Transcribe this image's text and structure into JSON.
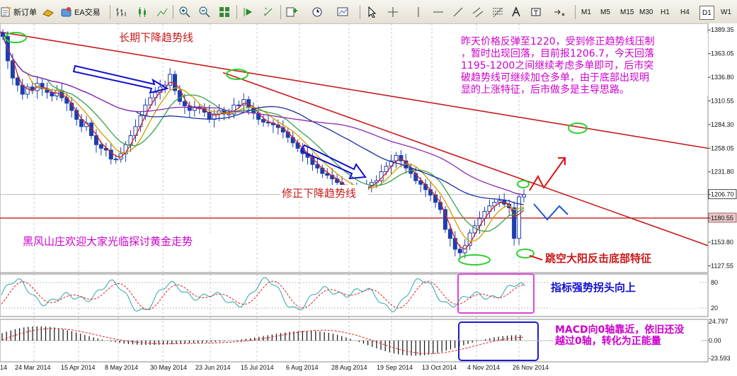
{
  "toolbar": {
    "new_order": "新订单",
    "ea_trading": "EA交易",
    "timeframes": [
      "M1",
      "M5",
      "M15",
      "M30",
      "H1",
      "H4",
      "D1",
      "W1"
    ],
    "active_timeframe": "D1"
  },
  "annotations": {
    "long_trend": "长期下降趋势线",
    "correction_trend": "修正下降趋势线",
    "welcome": "黑风山庄欢迎大家光临探讨黄金走势",
    "gap_candle": "跳空大阳反击底部特征",
    "indicator_note": "指标强势拐头向上",
    "macd_note_1": "MACD向0轴靠近，依旧还没",
    "macd_note_2": "越过0轴，转化为正能量",
    "analysis": [
      "昨天价格反弹至1220，受到修正趋势线压制",
      "，暂时出现回落，目前报1206.7，今天回落",
      "1195-1200之间继续考虑多单即可，后市突",
      "破趋势线可继续加仓多单，由于底部出现明",
      "显的上涨特征，后市做多是主导思路。"
    ]
  },
  "colors": {
    "candle": "#1c3fae",
    "ma_fast": "#d42020",
    "ma_mid": "#c9a000",
    "ma_slow": "#37a04a",
    "ma_blue": "#1a2fa0",
    "ma_purple": "#8b29b0",
    "trend": "#c81a1a",
    "ellipse": "#2ed02e",
    "magenta_text": "#cc00cc",
    "blue_text": "#1010cc",
    "price_marker": "#e8c8c8"
  },
  "chart_data": {
    "type": "candlestick",
    "price_axis": {
      "ticks": [
        "1389.35",
        "1363.05",
        "1336.80",
        "1310.55",
        "1284.30",
        "1258.05",
        "1231.80",
        "1206.70",
        "1180.55",
        "1153.80",
        "1127.55"
      ],
      "range": [
        1120,
        1395
      ],
      "current_price": "1206.70",
      "support_line": "1180.55"
    },
    "date_axis": [
      "14",
      "24 Mar 2014",
      "15 Apr 2014",
      "8 May 2014",
      "30 May 2014",
      "23 Jun 2014",
      "15 Jul 2014",
      "6 Aug 2014",
      "28 Aug 2014",
      "19 Sep 2014",
      "13 Oct 2014",
      "4 Nov 2014",
      "26 Nov 2014"
    ],
    "close_series": [
      1382,
      1355,
      1336,
      1328,
      1318,
      1326,
      1322,
      1330,
      1324,
      1320,
      1316,
      1322,
      1314,
      1308,
      1300,
      1290,
      1282,
      1286,
      1272,
      1262,
      1258,
      1256,
      1246,
      1246,
      1252,
      1262,
      1272,
      1282,
      1294,
      1306,
      1314,
      1320,
      1326,
      1328,
      1340,
      1322,
      1310,
      1305,
      1300,
      1304,
      1302,
      1298,
      1290,
      1296,
      1300,
      1296,
      1296,
      1306,
      1306,
      1312,
      1303,
      1297,
      1290,
      1287,
      1286,
      1284,
      1281,
      1276,
      1270,
      1264,
      1258,
      1252,
      1248,
      1240,
      1236,
      1230,
      1228,
      1224,
      1220,
      1214,
      1214,
      1212,
      1210,
      1212,
      1216,
      1220,
      1222,
      1232,
      1238,
      1244,
      1250,
      1244,
      1236,
      1230,
      1222,
      1218,
      1212,
      1206,
      1198,
      1190,
      1168,
      1158,
      1146,
      1142,
      1150,
      1164,
      1172,
      1180,
      1188,
      1194,
      1198,
      1200,
      1196,
      1192,
      1158,
      1204,
      1206.7
    ],
    "stochastic": {
      "range": [
        0,
        100
      ],
      "labels": [
        "80",
        "20"
      ]
    },
    "macd": {
      "labels": [
        "24.797",
        "0.00",
        "-23.593"
      ]
    }
  }
}
